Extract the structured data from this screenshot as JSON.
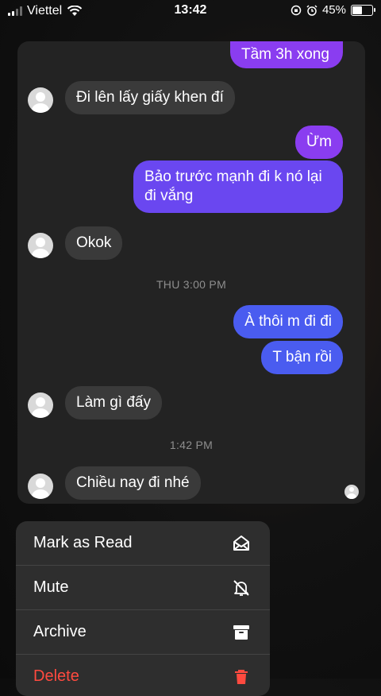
{
  "status_bar": {
    "carrier": "Viettel",
    "time": "13:42",
    "battery": "45%",
    "battery_level": 0.45
  },
  "messages": [
    {
      "text": "Tầm 3h xong",
      "side": "out"
    },
    {
      "text": "Đi lên lấy giấy khen đí",
      "side": "in"
    },
    {
      "text": "Ừm",
      "side": "out"
    },
    {
      "text": "Bảo trước mạnh đi k nó lại đi vắng",
      "side": "out"
    },
    {
      "text": "Okok",
      "side": "in"
    },
    {
      "text": "À thôi m đi đi",
      "side": "out"
    },
    {
      "text": "T bận rồi",
      "side": "out"
    },
    {
      "text": "Làm gì đấy",
      "side": "in"
    },
    {
      "text": "Chiều nay đi nhé",
      "side": "in"
    }
  ],
  "timestamps": [
    "THU 3:00 PM",
    "1:42 PM"
  ],
  "menu": {
    "items": [
      {
        "label": "Mark as Read",
        "icon": "envelope-open-icon"
      },
      {
        "label": "Mute",
        "icon": "bell-slash-icon"
      },
      {
        "label": "Archive",
        "icon": "archive-box-icon"
      },
      {
        "label": "Delete",
        "icon": "trash-icon"
      }
    ]
  },
  "colors": {
    "outgoing_top": "#8a3df0",
    "outgoing_bottom": "#4a5cf0",
    "incoming": "#3a3a3a",
    "danger": "#ff4a3f"
  }
}
